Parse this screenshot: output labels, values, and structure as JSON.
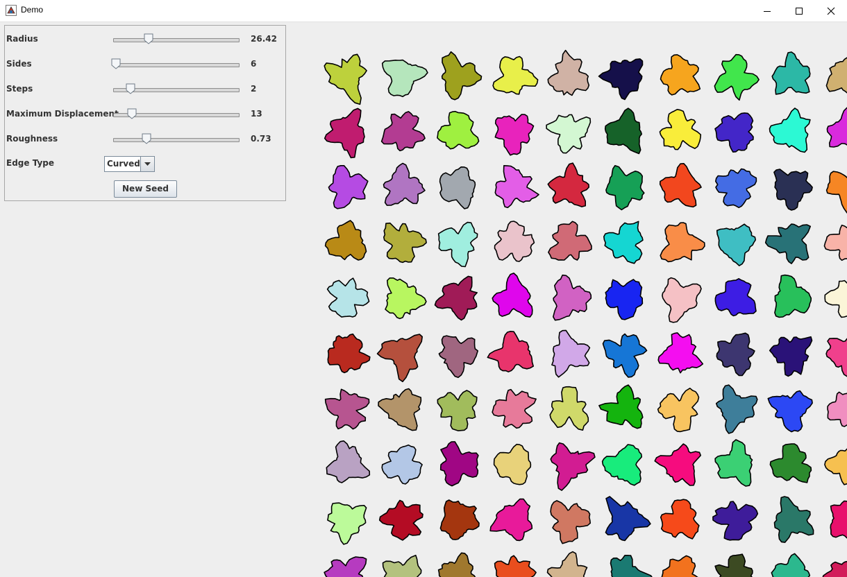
{
  "window": {
    "title": "Demo"
  },
  "controls": {
    "radius": {
      "label": "Radius",
      "value": "26.42",
      "level": 0.27
    },
    "sides": {
      "label": "Sides",
      "value": "6",
      "level": 0.0
    },
    "steps": {
      "label": "Steps",
      "value": "2",
      "level": 0.12
    },
    "displacement": {
      "label": "Maximum Displacement",
      "value": "13",
      "level": 0.13
    },
    "roughness": {
      "label": "Roughness",
      "value": "0.73",
      "level": 0.25
    },
    "edge_type": {
      "label": "Edge Type",
      "value": "Curved"
    },
    "new_seed": {
      "label": "New Seed"
    }
  },
  "blob_colors": [
    [
      "#bdd13c",
      "#b5e6bc",
      "#9ea11e",
      "#e8ef4a",
      "#d0b2a5",
      "#15104a",
      "#f6a51e",
      "#41e64c",
      "#2cb8a6",
      "#d0b070"
    ],
    [
      "#c01c6f",
      "#b33c92",
      "#9ff040",
      "#e823bc",
      "#d3f7d2",
      "#166229",
      "#f9ed3a",
      "#4326c8",
      "#2cf9d4",
      "#d92add"
    ],
    [
      "#b54be3",
      "#b075c2",
      "#a2a8af",
      "#e35ee7",
      "#d4283f",
      "#16a056",
      "#f2471e",
      "#446ce4",
      "#2a3054",
      "#f68624"
    ],
    [
      "#b98a16",
      "#b2ae3c",
      "#a0eedf",
      "#eac3cb",
      "#d06a76",
      "#15d6d2",
      "#f98d48",
      "#3fbec3",
      "#287277",
      "#f8b3a8"
    ],
    [
      "#b6e4e8",
      "#b8f660",
      "#a01b57",
      "#df06ec",
      "#d162c3",
      "#1825f2",
      "#f5c1c5",
      "#3d1de4",
      "#28c05b",
      "#fbf5d8"
    ],
    [
      "#b92a1f",
      "#b5503d",
      "#a06680",
      "#e8346c",
      "#d1a8e8",
      "#1676d6",
      "#f40ef0",
      "#3d3670",
      "#2a1278",
      "#f0408c"
    ],
    [
      "#b75590",
      "#b3946a",
      "#a1bc5c",
      "#e77a9a",
      "#d0d96a",
      "#14b40e",
      "#f8c460",
      "#3e7e9a",
      "#2c48f4",
      "#f08ec0"
    ],
    [
      "#b9a2c3",
      "#b3c7e6",
      "#a00684",
      "#e8d27a",
      "#d21c92",
      "#18ec7c",
      "#f60c7e",
      "#3bd074",
      "#2c8a2e",
      "#f6c050"
    ],
    [
      "#bcfa9a",
      "#b40c24",
      "#a4360f",
      "#e81a9a",
      "#d07862",
      "#1836a6",
      "#f64a1a",
      "#3e1c9a",
      "#2a7868",
      "#e8106c"
    ],
    [
      "#b63bc0",
      "#b3c27e",
      "#a0782e",
      "#e94e1e",
      "#d2b48e",
      "#1a7a72",
      "#f2721e",
      "#3c4a22",
      "#2cb88e",
      "#d21c5a"
    ]
  ]
}
